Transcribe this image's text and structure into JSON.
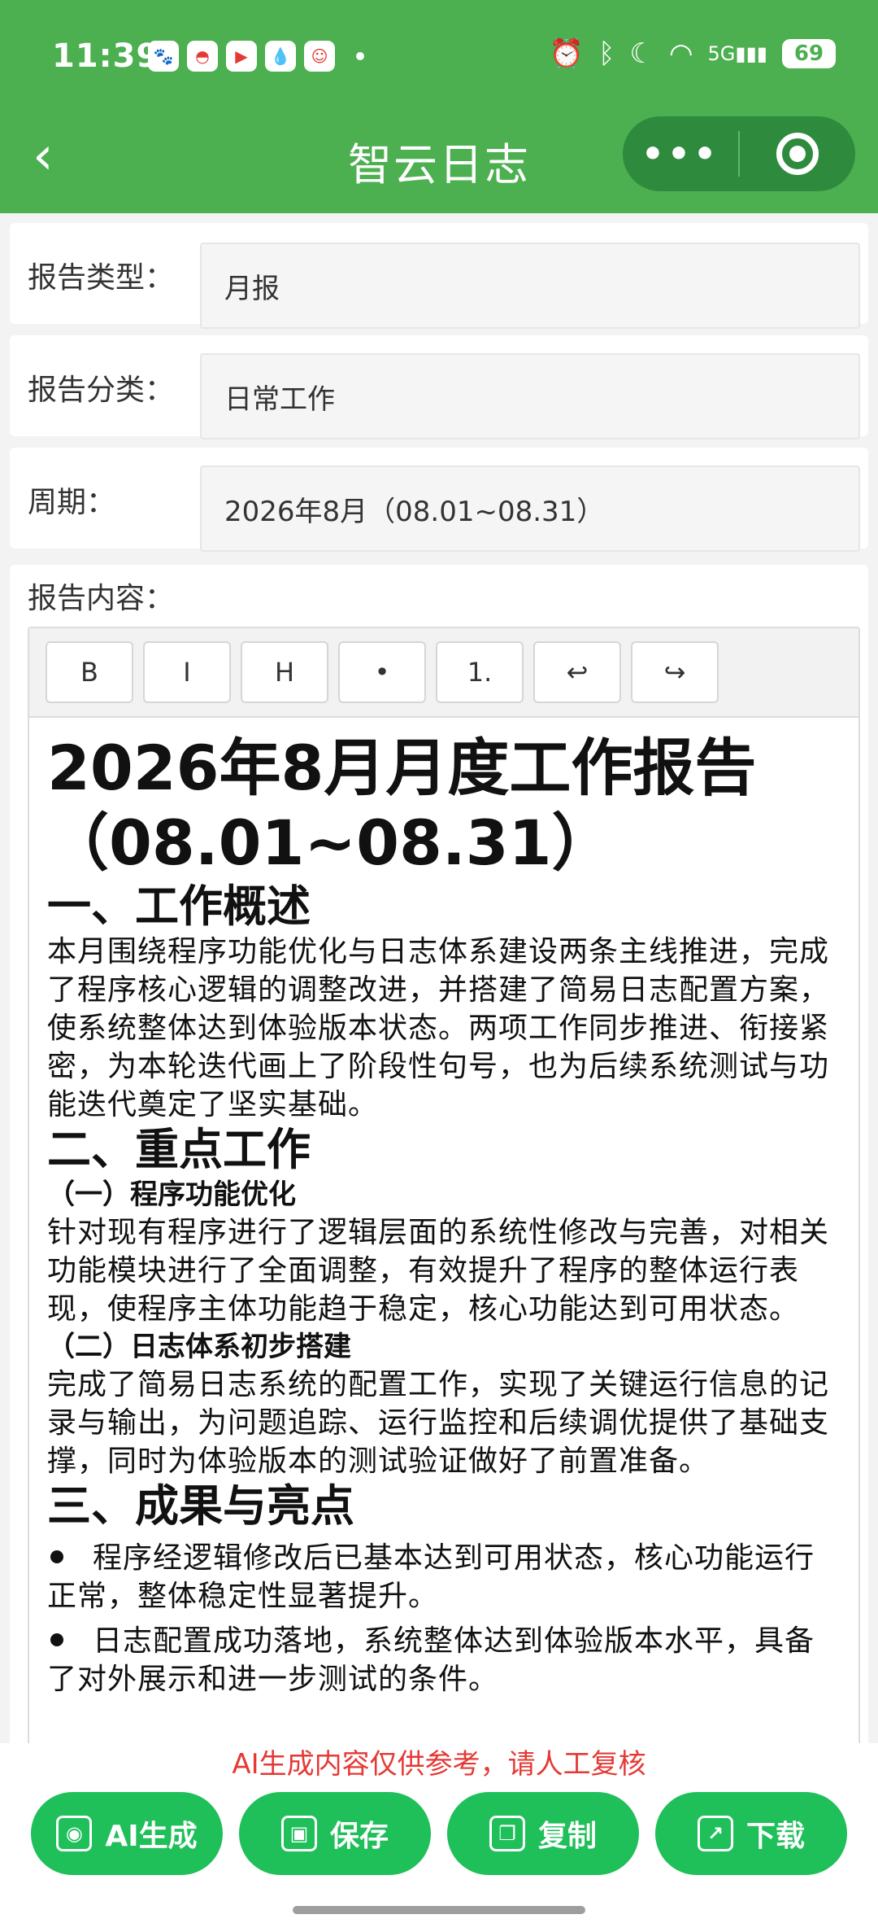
{
  "status_bar": {
    "time": "11:39",
    "battery": "69",
    "network": "5G"
  },
  "header": {
    "back_icon": "chevron-left-icon",
    "title": "智云日志",
    "more_icon": "more-dots-icon",
    "target_icon": "record-target-icon"
  },
  "form": {
    "report_type": {
      "label": "报告类型：",
      "value": "月报"
    },
    "report_category": {
      "label": "报告分类：",
      "value": "日常工作"
    },
    "period": {
      "label": "周期：",
      "value": "2026年8月（08.01~08.31）"
    }
  },
  "editor": {
    "label": "报告内容：",
    "toolbar": {
      "bold": "B",
      "italic": "I",
      "heading": "H",
      "bullet_list": "•",
      "ordered_list": "1.",
      "undo": "↩",
      "redo": "↪"
    },
    "content": {
      "title_line1": "2026年8月月度工作报告",
      "title_line2": "（08.01~08.31）",
      "section1_heading": "一、工作概述",
      "section1_text": "本月围绕程序功能优化与日志体系建设两条主线推进，完成了程序核心逻辑的调整改进，并搭建了简易日志配置方案，使系统整体达到体验版本状态。两项工作同步推进、衔接紧密，为本轮迭代画上了阶段性句号，也为后续系统测试与功能迭代奠定了坚实基础。",
      "section2_heading": "二、重点工作",
      "sub1_heading": "（一）程序功能优化",
      "sub1_text": "针对现有程序进行了逻辑层面的系统性修改与完善，对相关功能模块进行了全面调整，有效提升了程序的整体运行表现，使程序主体功能趋于稳定，核心功能达到可用状态。",
      "sub2_heading": "（二）日志体系初步搭建",
      "sub2_text": "完成了简易日志系统的配置工作，实现了关键运行信息的记录与输出，为问题追踪、运行监控和后续调优提供了基础支撑，同时为体验版本的测试验证做好了前置准备。",
      "section3_heading": "三、成果与亮点",
      "bullet1": "程序经逻辑修改后已基本达到可用状态，核心功能运行正常，整体稳定性显著提升。",
      "bullet2": "日志配置成功落地，系统整体达到体验版本水平，具备了对外展示和进一步测试的条件。"
    }
  },
  "notice": "AI生成内容仅供参考，请人工复核",
  "actions": {
    "ai_generate": "AI生成",
    "save": "保存",
    "copy": "复制",
    "download": "下载"
  }
}
